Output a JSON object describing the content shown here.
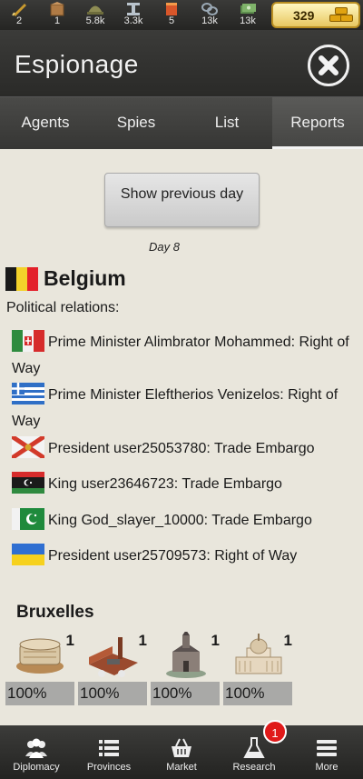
{
  "resources": [
    {
      "icon": "pen-icon",
      "value": "2"
    },
    {
      "icon": "box-icon",
      "value": "1"
    },
    {
      "icon": "helmet-icon",
      "value": "5.8k"
    },
    {
      "icon": "steel-icon",
      "value": "3.3k"
    },
    {
      "icon": "scroll-icon",
      "value": "5"
    },
    {
      "icon": "chain-icon",
      "value": "13k"
    },
    {
      "icon": "money-icon",
      "value": "13k"
    }
  ],
  "gold": {
    "value": "329"
  },
  "header": {
    "title": "Espionage"
  },
  "tabs": [
    {
      "label": "Agents"
    },
    {
      "label": "Spies"
    },
    {
      "label": "List"
    },
    {
      "label": "Reports",
      "active": true
    }
  ],
  "report": {
    "prev_button": "Show previous day",
    "day": "Day 8",
    "country": "Belgium",
    "relations_label": "Political relations:",
    "relations": [
      {
        "text": "Prime Minister Alimbrator Mohammed: Right of Way"
      },
      {
        "text": "Prime Minister Eleftherios Venizelos: Right of Way"
      },
      {
        "text": "President user25053780: Trade Embargo"
      },
      {
        "text": "King user23646723: Trade Embargo"
      },
      {
        "text": "King God_slayer_10000: Trade Embargo"
      },
      {
        "text": "President user25709573: Right of Way"
      }
    ],
    "city": "Bruxelles",
    "buildings": [
      {
        "icon": "arms-factory-icon",
        "count": "1",
        "percent": "100%"
      },
      {
        "icon": "industrial-complex-icon",
        "count": "1",
        "percent": "100%"
      },
      {
        "icon": "church-icon",
        "count": "1",
        "percent": "100%"
      },
      {
        "icon": "capitol-icon",
        "count": "1",
        "percent": "100%"
      }
    ]
  },
  "nav": [
    {
      "label": "Diplomacy",
      "icon": "people-icon"
    },
    {
      "label": "Provinces",
      "icon": "list-icon"
    },
    {
      "label": "Market",
      "icon": "basket-icon"
    },
    {
      "label": "Research",
      "icon": "flask-icon",
      "badge": "1"
    },
    {
      "label": "More",
      "icon": "menu-icon"
    }
  ]
}
